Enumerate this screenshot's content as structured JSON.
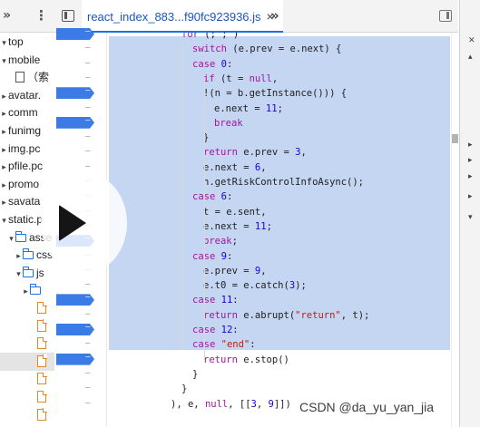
{
  "file_tree": {
    "rows": [
      {
        "label": "top",
        "indent": 0,
        "icon": "none",
        "twisty": "▾"
      },
      {
        "label": "mobile",
        "indent": 0,
        "icon": "cloud-icon",
        "twisty": "▾"
      },
      {
        "label": "（索",
        "indent": 1,
        "icon": "page-icon",
        "twisty": ""
      },
      {
        "label": "avatar.",
        "indent": 0,
        "icon": "cloud-icon",
        "twisty": "▸"
      },
      {
        "label": "comm",
        "indent": 0,
        "icon": "cloud-icon",
        "twisty": "▸"
      },
      {
        "label": "funimg",
        "indent": 0,
        "icon": "cloud-icon",
        "twisty": "▸"
      },
      {
        "label": "img.pc",
        "indent": 0,
        "icon": "cloud-icon",
        "twisty": "▸"
      },
      {
        "label": "pfile.pc",
        "indent": 0,
        "icon": "cloud-icon",
        "twisty": "▸"
      },
      {
        "label": "promo",
        "indent": 0,
        "icon": "cloud-icon",
        "twisty": "▸"
      },
      {
        "label": "savata",
        "indent": 0,
        "icon": "cloud-icon",
        "twisty": "▸"
      },
      {
        "label": "static.p",
        "indent": 0,
        "icon": "cloud-icon",
        "twisty": "▾"
      },
      {
        "label": "asse",
        "indent": 1,
        "icon": "folder-icon",
        "twisty": "▾"
      },
      {
        "label": "css",
        "indent": 2,
        "icon": "folder-icon",
        "twisty": "▸"
      },
      {
        "label": "js",
        "indent": 2,
        "icon": "folder-icon",
        "twisty": "▾"
      },
      {
        "label": "",
        "indent": 3,
        "icon": "folder-icon",
        "twisty": "▸"
      },
      {
        "label": "",
        "indent": 4,
        "icon": "file-icon",
        "twisty": ""
      },
      {
        "label": "",
        "indent": 4,
        "icon": "file-icon",
        "twisty": ""
      },
      {
        "label": "",
        "indent": 4,
        "icon": "file-icon",
        "twisty": ""
      },
      {
        "label": "",
        "indent": 4,
        "icon": "file-icon",
        "twisty": "",
        "selected": true
      },
      {
        "label": "",
        "indent": 4,
        "icon": "file-icon",
        "twisty": ""
      },
      {
        "label": "",
        "indent": 4,
        "icon": "file-icon",
        "twisty": ""
      },
      {
        "label": "",
        "indent": 4,
        "icon": "file-icon",
        "twisty": ""
      }
    ]
  },
  "editor": {
    "tab_title": "react_index_883...f90fc923936.js",
    "tab_close": "×",
    "overflow": "»",
    "sidebar_chevron": "»",
    "kebab": "⋮"
  },
  "gutter": {
    "breakpoint_lines": [
      0,
      4,
      6,
      14,
      18,
      20,
      22
    ],
    "line_count": 26
  },
  "code_lines": [
    {
      "indent": 6,
      "html": "<span class=\"kw\">for</span> (; ; )"
    },
    {
      "indent": 7,
      "html": "<span class=\"kw\">switch</span> (e.prev = e.next) {"
    },
    {
      "indent": 7,
      "html": "<span class=\"kw\">case</span> <span class=\"num\">0</span>:"
    },
    {
      "indent": 8,
      "html": "<span class=\"kw\">if</span> (t = <span class=\"kw\">null</span>,"
    },
    {
      "indent": 8,
      "html": "!(n = b.getInstance())) {"
    },
    {
      "indent": 9,
      "html": "e.next = <span class=\"num\">11</span>;"
    },
    {
      "indent": 9,
      "html": "<span class=\"kw\">break</span>"
    },
    {
      "indent": 8,
      "html": "}"
    },
    {
      "indent": 8,
      "html": "<span class=\"kw\">return</span> e.prev = <span class=\"num\">3</span>,"
    },
    {
      "indent": 8,
      "html": "e.next = <span class=\"num\">6</span>,"
    },
    {
      "indent": 8,
      "html": "n.getRiskControlInfoAsync();"
    },
    {
      "indent": 7,
      "html": "<span class=\"kw\">case</span> <span class=\"num\">6</span>:"
    },
    {
      "indent": 8,
      "html": "t = e.sent,"
    },
    {
      "indent": 8,
      "html": "e.next = <span class=\"num\">11</span>;"
    },
    {
      "indent": 8,
      "html": "<span class=\"kw\">break</span>;"
    },
    {
      "indent": 7,
      "html": "<span class=\"kw\">case</span> <span class=\"num\">9</span>:"
    },
    {
      "indent": 8,
      "html": "e.prev = <span class=\"num\">9</span>,"
    },
    {
      "indent": 8,
      "html": "e.t0 = e.catch(<span class=\"num\">3</span>);"
    },
    {
      "indent": 7,
      "html": "<span class=\"kw\">case</span> <span class=\"num\">11</span>:"
    },
    {
      "indent": 8,
      "html": "<span class=\"kw\">return</span> e.abrupt(<span class=\"str\">\"return\"</span>, t);"
    },
    {
      "indent": 7,
      "html": "<span class=\"kw\">case</span> <span class=\"num\">12</span>:"
    },
    {
      "indent": 7,
      "html": "<span class=\"kw\">case</span> <span class=\"str\">\"end\"</span>:"
    },
    {
      "indent": 8,
      "html": "<span class=\"kw\">return</span> e.stop()"
    },
    {
      "indent": 7,
      "html": "}"
    },
    {
      "indent": 6,
      "html": "}"
    },
    {
      "indent": 5,
      "html": "), e, <span class=\"kw\">null</span>, [[<span class=\"num\">3</span>, <span class=\"num\">9</span>]])"
    }
  ],
  "right_panel": {
    "items": [
      "✕",
      "▴",
      "",
      "",
      "",
      "",
      "",
      "",
      "",
      "",
      "▸",
      "▸",
      "▸",
      "▸",
      "▾"
    ]
  },
  "watermark": "CSDN @da_yu_yan_jia",
  "colors": {
    "breakpoint": "#3b7be8",
    "selection": "#c5d6f2",
    "keyword": "#a2159e",
    "number": "#1c00cf",
    "string": "#c41a16"
  }
}
